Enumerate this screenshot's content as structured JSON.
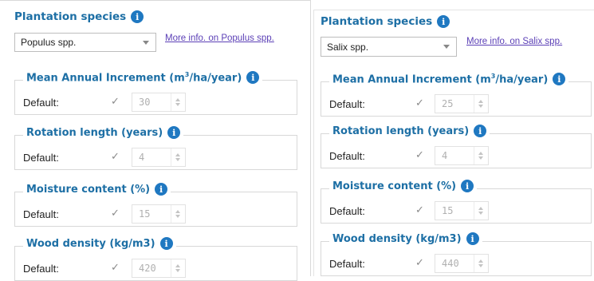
{
  "units_sup": "3",
  "panels": [
    {
      "species_label": "Plantation species",
      "species_value": "Populus spp.",
      "more_info": "More info. on Populus spp.",
      "params": [
        {
          "title_pre": "Mean Annual Increment (m",
          "title_post": "/ha/year)",
          "default_label": "Default:",
          "checked": true,
          "value": "30"
        },
        {
          "title": "Rotation length (years)",
          "default_label": "Default:",
          "checked": true,
          "value": "4"
        },
        {
          "title": "Moisture content (%)",
          "default_label": "Default:",
          "checked": true,
          "value": "15"
        },
        {
          "title": "Wood density (kg/m3)",
          "default_label": "Default:",
          "checked": true,
          "value": "420"
        }
      ]
    },
    {
      "species_label": "Plantation species",
      "species_value": "Salix spp.",
      "more_info": "More info. on Salix spp.",
      "params": [
        {
          "title_pre": "Mean Annual Increment (m",
          "title_post": "/ha/year)",
          "default_label": "Default:",
          "checked": true,
          "value": "25"
        },
        {
          "title": "Rotation length (years)",
          "default_label": "Default:",
          "checked": true,
          "value": "4"
        },
        {
          "title": "Moisture content (%)",
          "default_label": "Default:",
          "checked": true,
          "value": "15"
        },
        {
          "title": "Wood density (kg/m3)",
          "default_label": "Default:",
          "checked": true,
          "value": "440"
        }
      ]
    }
  ],
  "icons": {
    "info": "info-icon",
    "check": "checkmark-icon",
    "caret": "chevron-down-icon"
  },
  "colors": {
    "heading": "#1d6fa5",
    "info_badge": "#1f78c1",
    "link": "#5b3fb6"
  }
}
